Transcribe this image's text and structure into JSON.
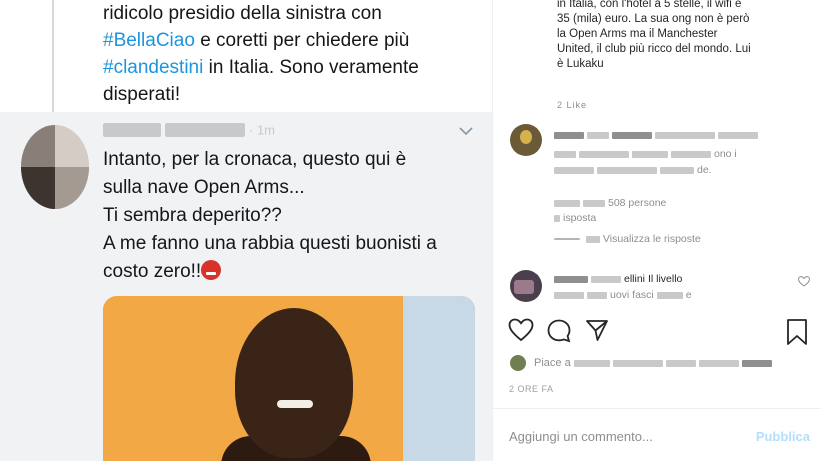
{
  "tweet_top": {
    "lines": [
      "ridicolo presidio della sinistra con",
      "e coretti per chiedere più",
      "in Italia. Sono veramente",
      "disperati!"
    ],
    "hashtag_bellaciao": "#BellaCiao",
    "hashtag_clandestini": "#clandestini"
  },
  "reply": {
    "handle_suffix": "· 1m",
    "chevron_icon": "chevron-down-icon",
    "lines": [
      "Intanto, per la cronaca, questo qui è",
      "sulla nave Open Arms...",
      "Ti sembra deperito??",
      "A me fanno una rabbia questi buonisti a",
      "costo zero!!"
    ],
    "emoji_icon": "angry-face-emoji"
  },
  "instagram": {
    "caption_lines": [
      "in Italia, con l'hotel a 5 stelle, il wifi e",
      "35 (mila) euro. La sua ong non è però",
      "la Open Arms ma il Manchester",
      "United, il club più ricco del mondo. Lui",
      "è Lukaku"
    ],
    "caption_meta": "2 Like",
    "comment1": {
      "partial_1": "ono i",
      "partial_2": "de.",
      "partial_3": "508 persone",
      "partial_4": "isposta",
      "view_replies": "Visualizza le risposte"
    },
    "comment2": {
      "name": "ellini",
      "text": "Il livello",
      "line2": "uovi fasci",
      "line2_end": "e"
    },
    "likes_text": "Piace a",
    "time": "2 ORE FA",
    "add_comment_placeholder": "Aggiungi un commento...",
    "publish_label": "Pubblica",
    "colors": {
      "hashtag": "#1b95e0",
      "publish": "#b2dffc",
      "reply_bg": "#f0f2f4"
    }
  }
}
